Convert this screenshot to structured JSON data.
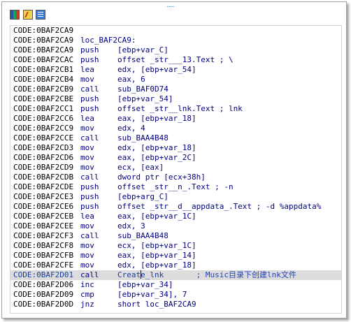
{
  "toolbar": {
    "icons": [
      "graph-view-icon",
      "edit-tool-icon",
      "text-view-icon"
    ]
  },
  "listing": {
    "rows": [
      {
        "addr": "CODE:0BAF2CA9",
        "mnem": "",
        "ops": "",
        "comment": ""
      },
      {
        "addr": "CODE:0BAF2CA9",
        "mnem": "",
        "ops": "loc_BAF2CA9:",
        "comment": ""
      },
      {
        "addr": "CODE:0BAF2CA9",
        "mnem": "push",
        "ops": "[ebp+var_C]",
        "comment": ""
      },
      {
        "addr": "CODE:0BAF2CAC",
        "mnem": "push",
        "ops": "offset _str___13.Text ; \\",
        "comment": ""
      },
      {
        "addr": "CODE:0BAF2CB1",
        "mnem": "lea",
        "ops": "edx, [ebp+var_54]",
        "comment": ""
      },
      {
        "addr": "CODE:0BAF2CB4",
        "mnem": "mov",
        "ops": "eax, 6",
        "comment": ""
      },
      {
        "addr": "CODE:0BAF2CB9",
        "mnem": "call",
        "ops": "sub_BAF0D74",
        "comment": ""
      },
      {
        "addr": "CODE:0BAF2CBE",
        "mnem": "push",
        "ops": "[ebp+var_54]",
        "comment": ""
      },
      {
        "addr": "CODE:0BAF2CC1",
        "mnem": "push",
        "ops": "offset _str__lnk.Text ; lnk",
        "comment": ""
      },
      {
        "addr": "CODE:0BAF2CC6",
        "mnem": "lea",
        "ops": "eax, [ebp+var_18]",
        "comment": ""
      },
      {
        "addr": "CODE:0BAF2CC9",
        "mnem": "mov",
        "ops": "edx, 4",
        "comment": ""
      },
      {
        "addr": "CODE:0BAF2CCE",
        "mnem": "call",
        "ops": "sub_BAA4B48",
        "comment": ""
      },
      {
        "addr": "CODE:0BAF2CD3",
        "mnem": "mov",
        "ops": "edx, [ebp+var_18]",
        "comment": ""
      },
      {
        "addr": "CODE:0BAF2CD6",
        "mnem": "mov",
        "ops": "eax, [ebp+var_2C]",
        "comment": ""
      },
      {
        "addr": "CODE:0BAF2CD9",
        "mnem": "mov",
        "ops": "ecx, [eax]",
        "comment": ""
      },
      {
        "addr": "CODE:0BAF2CDB",
        "mnem": "call",
        "ops": "dword ptr [ecx+38h]",
        "comment": ""
      },
      {
        "addr": "CODE:0BAF2CDE",
        "mnem": "push",
        "ops": "offset _str__n_.Text ; -n",
        "comment": ""
      },
      {
        "addr": "CODE:0BAF2CE3",
        "mnem": "push",
        "ops": "[ebp+arg_C]",
        "comment": ""
      },
      {
        "addr": "CODE:0BAF2CE6",
        "mnem": "push",
        "ops": "offset _str__d__appdata_.Text ; -d %appdata%",
        "comment": ""
      },
      {
        "addr": "CODE:0BAF2CEB",
        "mnem": "lea",
        "ops": "eax, [ebp+var_1C]",
        "comment": ""
      },
      {
        "addr": "CODE:0BAF2CEE",
        "mnem": "mov",
        "ops": "edx, 3",
        "comment": ""
      },
      {
        "addr": "CODE:0BAF2CF3",
        "mnem": "call",
        "ops": "sub_BAA4B48",
        "comment": ""
      },
      {
        "addr": "CODE:0BAF2CF8",
        "mnem": "mov",
        "ops": "ecx, [ebp+var_1C]",
        "comment": ""
      },
      {
        "addr": "CODE:0BAF2CFB",
        "mnem": "mov",
        "ops": "eax, [ebp+var_14]",
        "comment": ""
      },
      {
        "addr": "CODE:0BAF2CFE",
        "mnem": "mov",
        "ops": "edx, [ebp+var_18]",
        "comment": ""
      },
      {
        "addr": "CODE:0BAF2D01",
        "mnem": "call",
        "ops_pre": "Creat",
        "ops_post": "e_lnk",
        "comment": "; Music目录下创建lnk文件",
        "selected": true
      },
      {
        "addr": "CODE:0BAF2D06",
        "mnem": "inc",
        "ops": "[ebp+var_34]",
        "comment": ""
      },
      {
        "addr": "CODE:0BAF2D09",
        "mnem": "cmp",
        "ops": "[ebp+var_34], 7",
        "comment": ""
      },
      {
        "addr": "CODE:0BAF2D0D",
        "mnem": "jnz",
        "ops": "short loc_BAF2CA9",
        "comment": ""
      }
    ]
  }
}
